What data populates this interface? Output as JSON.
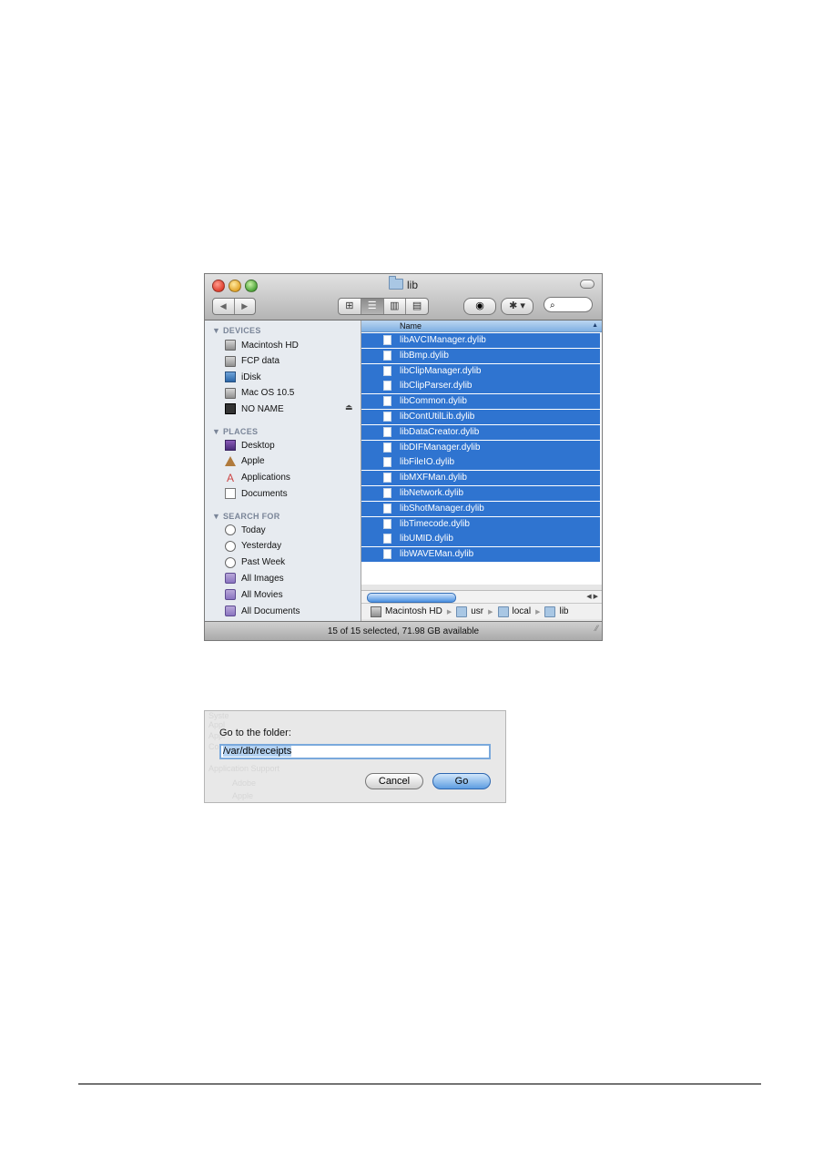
{
  "window": {
    "title": "lib",
    "view_buttons": [
      "icon-view",
      "list-view",
      "column-view",
      "coverflow-view"
    ],
    "active_view": "list-view",
    "search_placeholder": "",
    "eye_icon": "◉",
    "gear_icon": "✱ ▾",
    "search_icon": "⌕"
  },
  "sidebar": {
    "devices_header": "▼ DEVICES",
    "devices": [
      {
        "label": "Macintosh HD",
        "icon": "harddisk-icon"
      },
      {
        "label": "FCP data",
        "icon": "harddisk-icon"
      },
      {
        "label": "iDisk",
        "icon": "idisk-icon"
      },
      {
        "label": "Mac OS 10.5",
        "icon": "harddisk-icon"
      },
      {
        "label": "NO NAME",
        "icon": "usb-drive-icon"
      }
    ],
    "eject_icon": "⏏",
    "places_header": "▼ PLACES",
    "places": [
      {
        "label": "Desktop",
        "icon": "desktop-icon"
      },
      {
        "label": "Apple",
        "icon": "home-icon"
      },
      {
        "label": "Applications",
        "icon": "applications-icon"
      },
      {
        "label": "Documents",
        "icon": "documents-icon"
      }
    ],
    "search_header": "▼ SEARCH FOR",
    "searches": [
      {
        "label": "Today",
        "icon": "clock-icon"
      },
      {
        "label": "Yesterday",
        "icon": "clock-icon"
      },
      {
        "label": "Past Week",
        "icon": "clock-icon"
      },
      {
        "label": "All Images",
        "icon": "smart-folder-icon"
      },
      {
        "label": "All Movies",
        "icon": "smart-folder-icon"
      },
      {
        "label": "All Documents",
        "icon": "smart-folder-icon"
      }
    ]
  },
  "list": {
    "column_header": "Name",
    "sort_indicator": "▲",
    "files": [
      "libAVCIManager.dylib",
      "libBmp.dylib",
      "libClipManager.dylib",
      "libClipParser.dylib",
      "libCommon.dylib",
      "libContUtilLib.dylib",
      "libDataCreator.dylib",
      "libDIFManager.dylib",
      "libFileIO.dylib",
      "libMXFMan.dylib",
      "libNetwork.dylib",
      "libShotManager.dylib",
      "libTimecode.dylib",
      "libUMID.dylib",
      "libWAVEMan.dylib"
    ],
    "selected_color": "#2f74d0"
  },
  "pathbar": [
    "Macintosh HD",
    "usr",
    "local",
    "lib"
  ],
  "status": {
    "text": "15 of 15 selected, 71.98 GB available"
  },
  "dialog": {
    "label": "Go to the folder:",
    "value": "/var/db/receipts",
    "cancel": "Cancel",
    "go": "Go",
    "ghost_lines": [
      "Syste",
      "Appl",
      "Appl",
      "Cont",
      "Application Support",
      "Adobe",
      "Apple"
    ]
  }
}
